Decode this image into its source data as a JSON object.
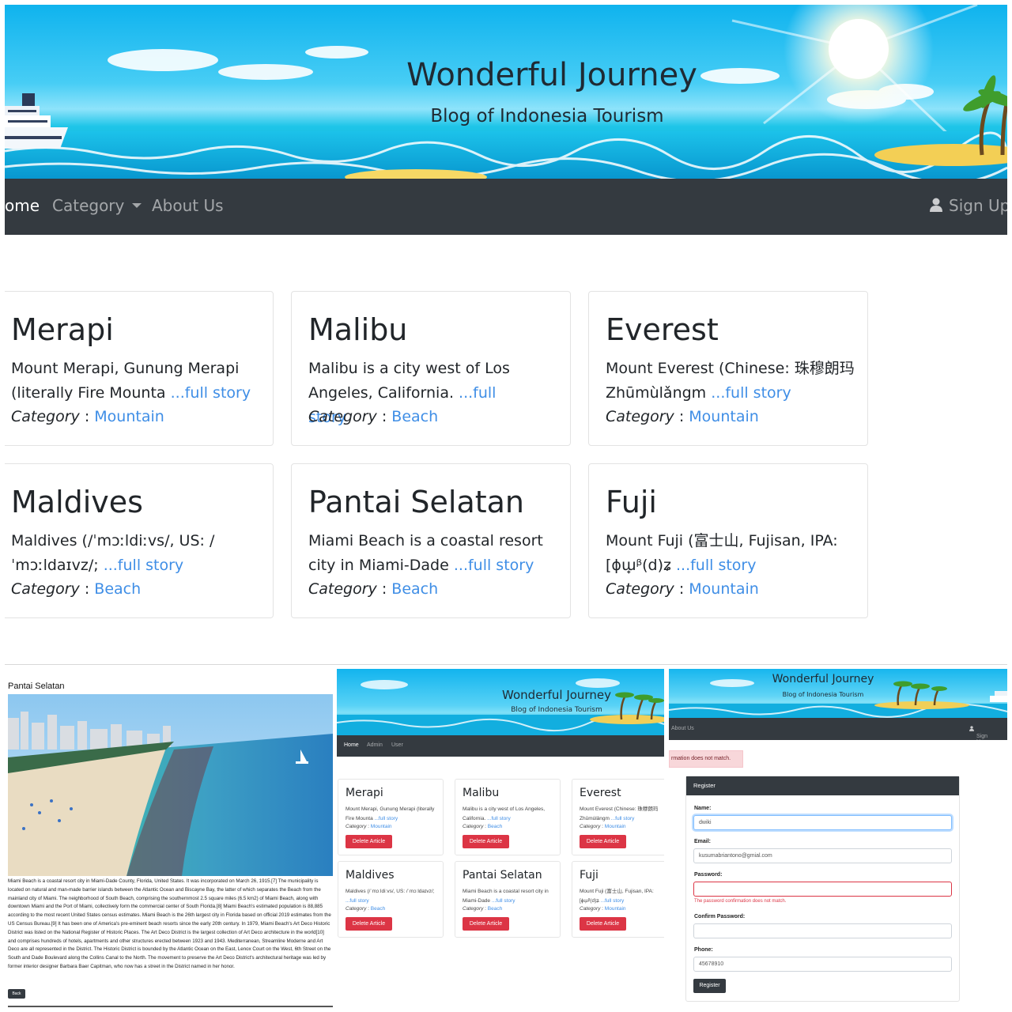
{
  "site": {
    "title": "Wonderful Journey",
    "subtitle": "Blog of Indonesia Tourism"
  },
  "nav": {
    "home": "ome",
    "category": "Category",
    "about": "About Us",
    "signup": "Sign Up"
  },
  "articles": [
    {
      "title": "Merapi",
      "excerpt": "Mount Merapi, Gunung Merapi (literally Fire Mounta",
      "more": "...full story",
      "category_label": "Category",
      "category": "Mountain"
    },
    {
      "title": "Malibu",
      "excerpt": "Malibu is a city west of Los Angeles, California.",
      "more": "...full story",
      "category_label": "Category",
      "category": "Beach"
    },
    {
      "title": "Everest",
      "excerpt": "Mount Everest (Chinese: 珠穆朗玛 Zhūmùlǎngm",
      "more": "...full story",
      "category_label": "Category",
      "category": "Mountain"
    },
    {
      "title": "Maldives",
      "excerpt": "Maldives (/ˈmɔːldiːvs/, US: /ˈmɔːldaɪvz/;",
      "more": "...full story",
      "category_label": "Category",
      "category": "Beach"
    },
    {
      "title": "Pantai Selatan",
      "excerpt": "Miami Beach is a coastal resort city in Miami-Dade",
      "more": "...full story",
      "category_label": "Category",
      "category": "Beach"
    },
    {
      "title": "Fuji",
      "excerpt": "Mount Fuji (富士山, Fujisan, IPA: [ɸɯ̟ᵝ(d)ʑ",
      "more": "...full story",
      "category_label": "Category",
      "category": "Mountain"
    }
  ],
  "detail": {
    "title": "Pantai Selatan",
    "body": "Miami Beach is a coastal resort city in Miami-Dade County, Florida, United States. It was incorporated on March 26, 1915.[7] The municipality is located on natural and man-made barrier islands between the Atlantic Ocean and Biscayne Bay, the latter of which separates the Beach from the mainland city of Miami. The neighborhood of South Beach, comprising the southernmost 2.5 square miles (6.5 km2) of Miami Beach, along with downtown Miami and the Port of Miami, collectively form the commercial center of South Florida.[8] Miami Beach's estimated population is 88,885 according to the most recent United States census estimates. Miami Beach is the 26th largest city in Florida based on official 2019 estimates from the US Census Bureau.[9] It has been one of America's pre-eminent beach resorts since the early 20th century. In 1979, Miami Beach's Art Deco Historic District was listed on the National Register of Historic Places. The Art Deco District is the largest collection of Art Deco architecture in the world[10] and comprises hundreds of hotels, apartments and other structures erected between 1923 and 1943. Mediterranean, Streamline Moderne and Art Deco are all represented in the District. The Historic District is bounded by the Atlantic Ocean on the East, Lenox Court on the West, 6th Street on the South and Dade Boulevard along the Collins Canal to the North. The movement to preserve the Art Deco District's architectural heritage was led by former interior designer Barbara Baer Capitman, who now has a street in the District named in her honor.",
    "back": "Back"
  },
  "admin": {
    "nav": {
      "home": "Home",
      "admin": "Admin",
      "user": "User"
    },
    "delete": "Delete Article",
    "articles": [
      {
        "title": "Merapi",
        "excerpt": "Mount Merapi, Gunung Merapi (literally Fire Mounta",
        "more": "...full story",
        "category": "Mountain"
      },
      {
        "title": "Malibu",
        "excerpt": "Malibu is a city west of Los Angeles, California.",
        "more": "...full story",
        "category": "Beach"
      },
      {
        "title": "Everest",
        "excerpt": "Mount Everest (Chinese: 珠穆朗玛 Zhūmùlǎngm",
        "more": "...full story",
        "category": "Mountain"
      },
      {
        "title": "Maldives",
        "excerpt": "Maldives (/ˈmɔːldiːvs/, US: /ˈmɔːldaɪvz/;",
        "more": "...full story",
        "category": "Beach"
      },
      {
        "title": "Pantai Selatan",
        "excerpt": "Miami Beach is a coastal resort city in Miami-Dade",
        "more": "...full story",
        "category": "Beach"
      },
      {
        "title": "Fuji",
        "excerpt": "Mount Fuji (富士山, Fujisan, IPA: [ɸɯ̟ᵝ(d)ʑ",
        "more": "...full story",
        "category": "Mountain"
      }
    ]
  },
  "register": {
    "nav": {
      "about": "About Us",
      "signup": "Sign Up"
    },
    "alert": "rmation does not match.",
    "header": "Register",
    "name_label": "Name:",
    "name_value": "dwiki",
    "email_label": "Email:",
    "email_value": "kusumabriantono@gmial.com",
    "password_label": "Password:",
    "password_error": "The password confirmation does not match.",
    "confirm_label": "Confirm Password:",
    "phone_label": "Phone:",
    "phone_value": "45678910",
    "submit": "Register"
  },
  "colors": {
    "navbar": "#343a40",
    "link": "#3f8ee6",
    "danger": "#dc3545",
    "sky": "#0fb3ee"
  }
}
